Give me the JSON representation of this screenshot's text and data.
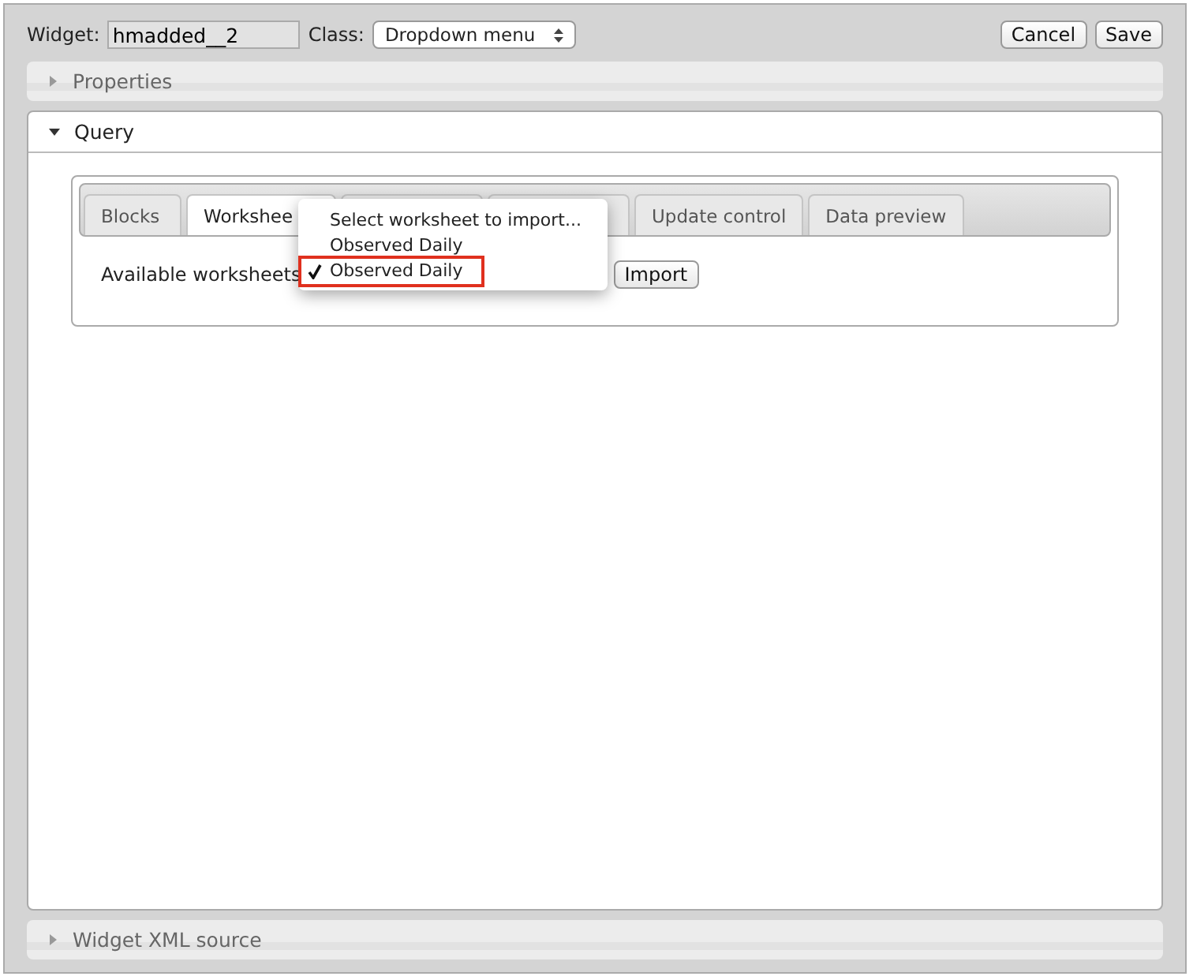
{
  "toolbar": {
    "widget_label": "Widget:",
    "widget_value": "hmadded__2",
    "class_label": "Class:",
    "class_value": "Dropdown menu",
    "buttons": [
      "Cancel",
      "Save"
    ]
  },
  "sections": [
    {
      "title": "Properties",
      "expanded": false
    },
    {
      "title": "Query",
      "expanded": true,
      "tabs": [
        {
          "label": "Blocks",
          "selected": false
        },
        {
          "label": "Workshee",
          "selected": true
        },
        {
          "selected": false
        },
        {
          "selected": false
        },
        {
          "label": "Update control",
          "selected": false
        },
        {
          "label": "Data preview",
          "selected": false
        }
      ],
      "field_label": "Available worksheets",
      "import_button": "Import",
      "dropdown_options": [
        {
          "label": "Select worksheet to import...",
          "checked": false,
          "highlighted": false
        },
        {
          "label": "Observed Daily",
          "checked": false,
          "highlighted": false
        },
        {
          "label": "Observed Daily",
          "checked": true,
          "highlighted": true
        }
      ]
    },
    {
      "title": "Widget XML source",
      "expanded": false
    }
  ]
}
